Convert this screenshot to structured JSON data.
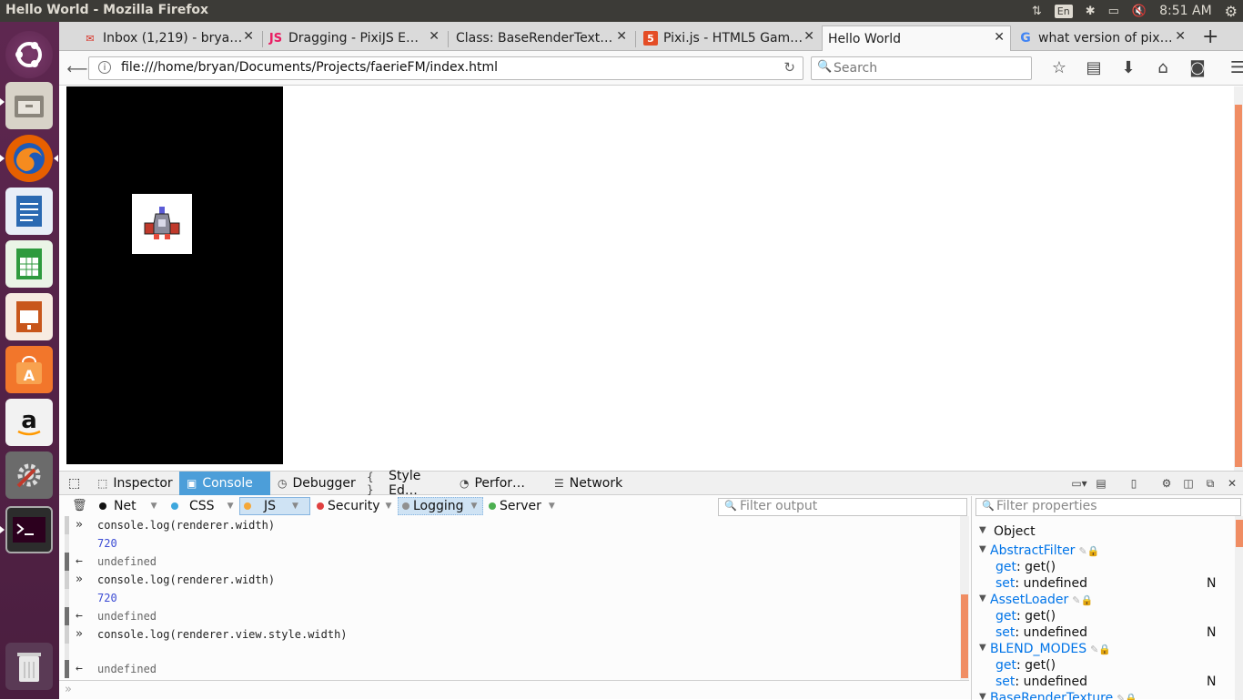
{
  "topbar": {
    "title": "Hello World - Mozilla Firefox",
    "lang": "En",
    "clock": "8:51 AM"
  },
  "tabs": [
    {
      "label": "Inbox (1,219) - brya…",
      "icon": "gmail-icon"
    },
    {
      "label": "Dragging - PixiJS E…",
      "icon": "js-icon"
    },
    {
      "label": "Class: BaseRenderText…",
      "icon": "none"
    },
    {
      "label": "Pixi.js - HTML5 Gam…",
      "icon": "html5-icon"
    },
    {
      "label": "Hello World",
      "icon": "none"
    },
    {
      "label": "what version of pix…",
      "icon": "google-icon"
    }
  ],
  "navbar": {
    "url": "file:///home/bryan/Documents/Projects/faerieFM/index.html",
    "search_placeholder": "Search"
  },
  "devtools": {
    "tabs": [
      "Inspector",
      "Console",
      "Debugger",
      "Style Ed…",
      "Perfor…",
      "Network"
    ],
    "filters": [
      {
        "label": "Net",
        "color": "#111111"
      },
      {
        "label": "CSS",
        "color": "#3ea7dd"
      },
      {
        "label": "JS",
        "color": "#f4a738"
      },
      {
        "label": "Security",
        "color": "#e04040"
      },
      {
        "label": "Logging",
        "color": "#909090"
      },
      {
        "label": "Server",
        "color": "#4caf50"
      }
    ],
    "filter_output_placeholder": "Filter output",
    "filter_properties_placeholder": "Filter properties",
    "console_rows": [
      {
        "type": "input",
        "text": "console.log(renderer.width)"
      },
      {
        "type": "log",
        "text": "720"
      },
      {
        "type": "result",
        "text": "undefined"
      },
      {
        "type": "input",
        "text": "console.log(renderer.width)"
      },
      {
        "type": "log",
        "text": "720"
      },
      {
        "type": "result",
        "text": "undefined"
      },
      {
        "type": "input",
        "text": "console.log(renderer.view.style.width)"
      },
      {
        "type": "log",
        "text": ""
      },
      {
        "type": "result",
        "text": "undefined"
      }
    ],
    "props": [
      {
        "level": 0,
        "key": "Object",
        "value": "",
        "n": ""
      },
      {
        "level": 1,
        "key": "AbstractFilter",
        "value": "",
        "n": ""
      },
      {
        "level": 2,
        "key": "get",
        "value": "get()",
        "n": ""
      },
      {
        "level": 2,
        "key": "set",
        "value": "undefined",
        "n": "N"
      },
      {
        "level": 1,
        "key": "AssetLoader",
        "value": "",
        "n": ""
      },
      {
        "level": 2,
        "key": "get",
        "value": "get()",
        "n": ""
      },
      {
        "level": 2,
        "key": "set",
        "value": "undefined",
        "n": "N"
      },
      {
        "level": 1,
        "key": "BLEND_MODES",
        "value": "",
        "n": ""
      },
      {
        "level": 2,
        "key": "get",
        "value": "get()",
        "n": ""
      },
      {
        "level": 2,
        "key": "set",
        "value": "undefined",
        "n": "N"
      },
      {
        "level": 1,
        "key": "BaseRenderTexture",
        "value": "",
        "n": ""
      }
    ]
  }
}
